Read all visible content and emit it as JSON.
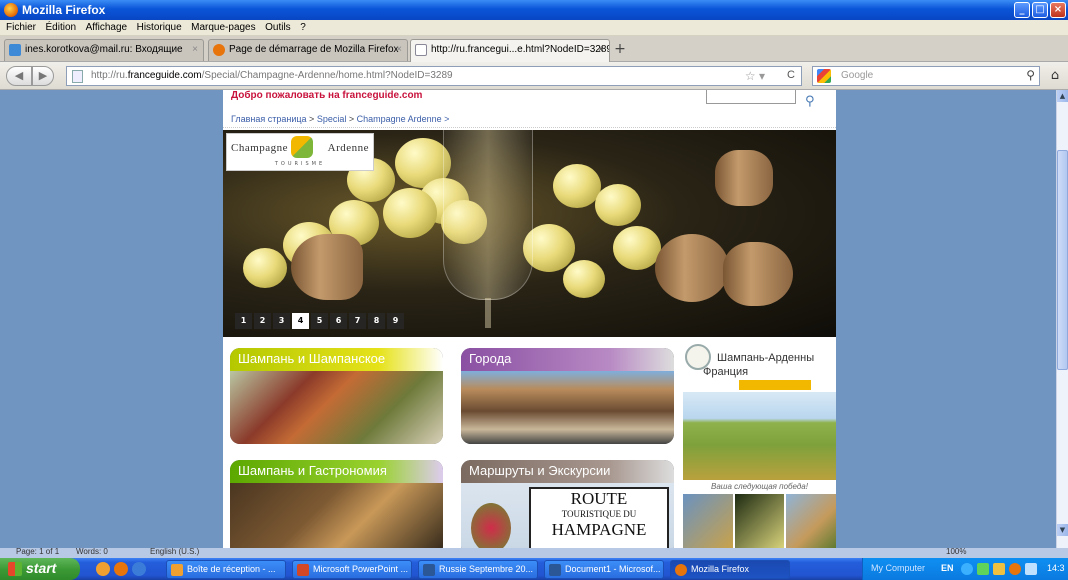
{
  "window": {
    "title": "Mozilla Firefox"
  },
  "menu": [
    "Fichier",
    "Édition",
    "Affichage",
    "Historique",
    "Marque-pages",
    "Outils",
    "?"
  ],
  "tabs": [
    {
      "label": "ines.korotkova@mail.ru: Входящие",
      "icon": "mail-icon"
    },
    {
      "label": "Page de démarrage de Mozilla Firefox",
      "icon": "firefox-icon"
    },
    {
      "label": "http://ru.francegui...e.html?NodeID=3289",
      "icon": "page-icon"
    }
  ],
  "address": {
    "prefix": "http://ru.",
    "domain": "franceguide.com",
    "path": "/Special/Champagne-Ardenne/home.html?NodeID=3289"
  },
  "search": {
    "placeholder": "Google"
  },
  "page": {
    "welcome": "Добро пожаловать на franceguide.com",
    "breadcrumb": {
      "home": "Главная страница",
      "sep1": " > ",
      "special": "Special",
      "sep2": " > ",
      "current": "Champagne Ardenne >"
    },
    "logo": {
      "left": "Champagne",
      "right": "Ardenne",
      "sub": "TOURISME"
    },
    "pager": [
      "1",
      "2",
      "3",
      "4",
      "5",
      "6",
      "7",
      "8",
      "9"
    ],
    "pager_active": "4",
    "cards": [
      {
        "title": "Шампань и Шампанское"
      },
      {
        "title": "Города"
      },
      {
        "title": "Шампань и Гастрономия"
      },
      {
        "title": "Маршруты и Экскурсии"
      }
    ],
    "route_sign": {
      "l1": "ROUTE",
      "l2": "TOURISTIQUE DU",
      "l3": "HAMPAGNE"
    },
    "promo": {
      "line1": "Шампань-Арденны",
      "line2": "Франция",
      "slogan": "Ваша следующая победа!"
    }
  },
  "word_status": {
    "page": "Page: 1 of 1",
    "words": "Words: 0",
    "lang": "English (U.S.)",
    "zoom": "100%"
  },
  "taskbar": {
    "start": "start",
    "items": [
      {
        "label": "Boîte de réception - ...",
        "color": "#f0a030"
      },
      {
        "label": "Microsoft PowerPoint ...",
        "color": "#d24726"
      },
      {
        "label": "Russie Septembre 20...",
        "color": "#2b5797"
      },
      {
        "label": "Document1 - Microsof...",
        "color": "#2b5797"
      },
      {
        "label": "Mozilla Firefox",
        "color": "#e8740c"
      }
    ],
    "tray": {
      "computer": "My Computer",
      "lang": "EN",
      "time": "14:3"
    }
  }
}
